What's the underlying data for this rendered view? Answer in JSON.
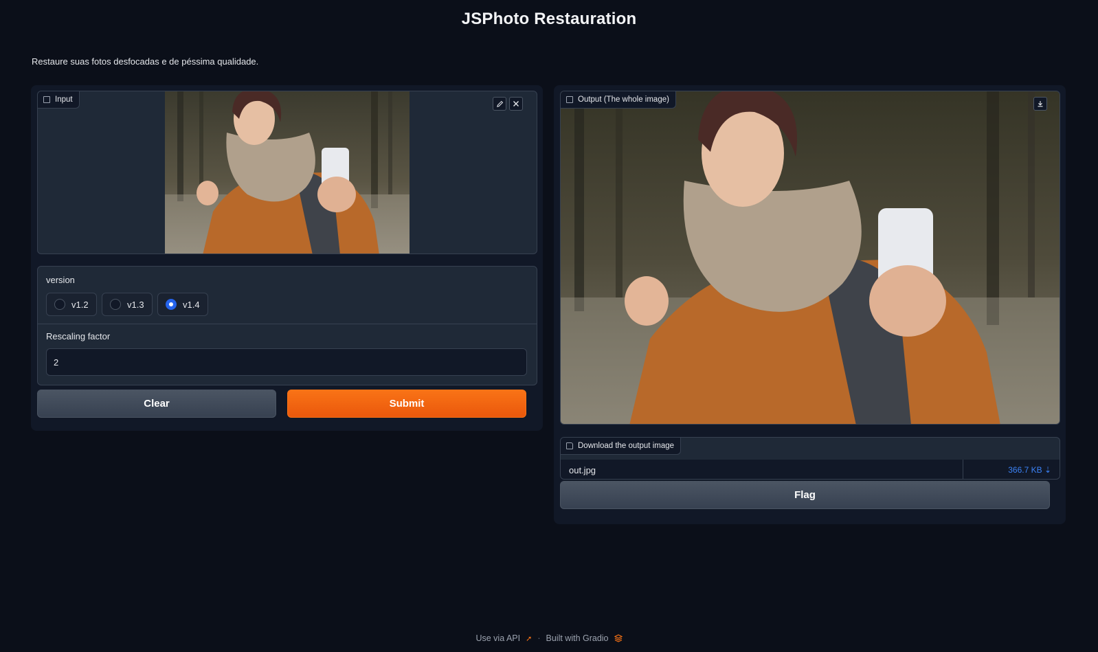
{
  "header": {
    "title": "JSPhoto Restauration",
    "description": "Restaure suas fotos desfocadas e de péssima qualidade."
  },
  "input_panel": {
    "image_label": "Input",
    "image_label_icon": "image-icon",
    "edit_icon": "pencil-icon",
    "clear_icon": "close-icon",
    "version": {
      "label": "version",
      "options": [
        "v1.2",
        "v1.3",
        "v1.4"
      ],
      "selected": "v1.4"
    },
    "rescaling": {
      "label": "Rescaling factor",
      "value": "2"
    },
    "clear_label": "Clear",
    "submit_label": "Submit"
  },
  "output_panel": {
    "image_label": "Output (The whole image)",
    "image_label_icon": "image-icon",
    "download_icon": "download-icon",
    "download": {
      "label": "Download the output image",
      "file_name": "out.jpg",
      "file_size": "366.7 KB ⇣"
    },
    "flag_label": "Flag"
  },
  "footer": {
    "api_label": "Use via API",
    "separator": "·",
    "built_with": "Built with Gradio"
  },
  "colors": {
    "background": "#0b0f19",
    "panel": "#111827",
    "block": "#1f2937",
    "accent": "#f97316",
    "radio_checked": "#2563eb",
    "link": "#3b82f6"
  }
}
